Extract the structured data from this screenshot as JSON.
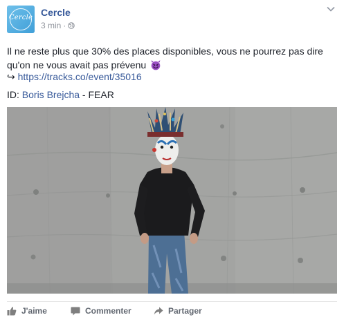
{
  "post": {
    "page_name": "Cercle",
    "avatar_text": "Cercle",
    "timestamp": "3 min",
    "separator": "·",
    "text_line1": "Il ne reste plus que 30% des places disponibles, vous ne pourrez pas dire qu'on ne vous avait pas prévenu",
    "arrow": "↪",
    "link_url": "https://tracks.co/event/35016",
    "id_prefix": "ID: ",
    "artist": "Boris Brejcha",
    "track_suffix": " - FEAR"
  },
  "actions": {
    "like": "J'aime",
    "comment": "Commenter",
    "share": "Partager"
  },
  "icons": {
    "globe": "globe-icon",
    "chevron": "chevron-down-icon",
    "emoji": "smiling-devil-emoji-icon",
    "like": "thumbs-up-icon",
    "comment": "comment-bubble-icon",
    "share": "share-arrow-icon"
  },
  "colors": {
    "link": "#365899",
    "secondary": "#90949c",
    "action": "#616770",
    "emoji": "#8a3cb5"
  }
}
